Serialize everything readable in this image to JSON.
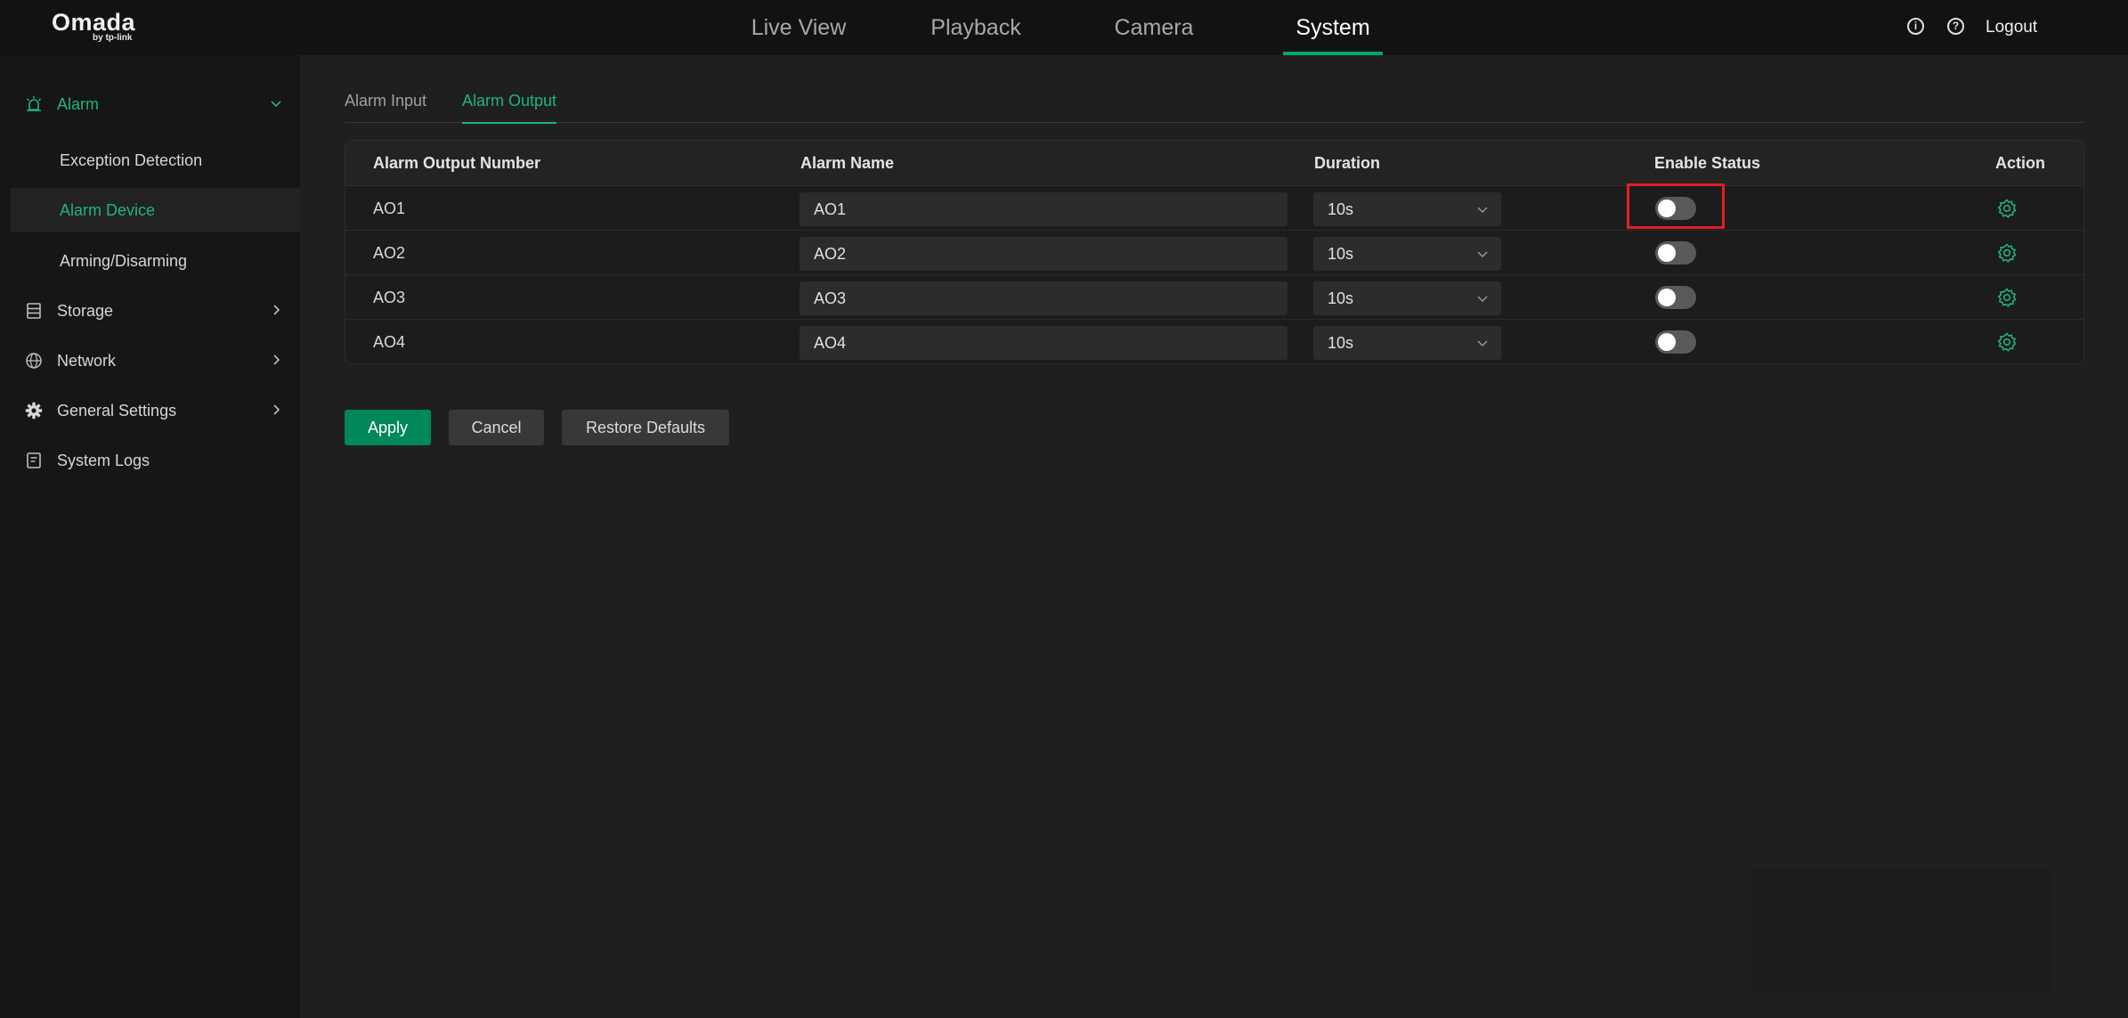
{
  "brand": {
    "name": "Omada",
    "sub": "by tp-link"
  },
  "top_nav": [
    {
      "label": "Live View"
    },
    {
      "label": "Playback"
    },
    {
      "label": "Camera"
    },
    {
      "label": "System",
      "active": true
    }
  ],
  "header": {
    "logout_label": "Logout",
    "icons": [
      "info-icon",
      "help-icon"
    ]
  },
  "sidebar": {
    "groups": [
      {
        "label": "Alarm",
        "icon": "alarm-light-icon",
        "expanded": true,
        "children": [
          {
            "label": "Exception Detection"
          },
          {
            "label": "Alarm Device",
            "active": true
          },
          {
            "label": "Arming/Disarming"
          }
        ]
      },
      {
        "label": "Storage",
        "icon": "storage-icon"
      },
      {
        "label": "Network",
        "icon": "globe-icon"
      },
      {
        "label": "General Settings",
        "icon": "gear-icon"
      },
      {
        "label": "System Logs",
        "icon": "log-icon"
      }
    ]
  },
  "tabs": [
    {
      "label": "Alarm Input"
    },
    {
      "label": "Alarm Output",
      "active": true
    }
  ],
  "table": {
    "columns": [
      "Alarm Output Number",
      "Alarm Name",
      "Duration",
      "Enable Status",
      "Action"
    ],
    "rows": [
      {
        "number": "AO1",
        "name": "AO1",
        "duration": "10s",
        "enabled": false
      },
      {
        "number": "AO2",
        "name": "AO2",
        "duration": "10s",
        "enabled": false
      },
      {
        "number": "AO3",
        "name": "AO3",
        "duration": "10s",
        "enabled": false
      },
      {
        "number": "AO4",
        "name": "AO4",
        "duration": "10s",
        "enabled": false
      }
    ]
  },
  "buttons": {
    "apply": "Apply",
    "cancel": "Cancel",
    "restore": "Restore Defaults"
  },
  "colors": {
    "accent": "#00a870",
    "primary_button": "#00875a",
    "highlight": "#e02020"
  }
}
